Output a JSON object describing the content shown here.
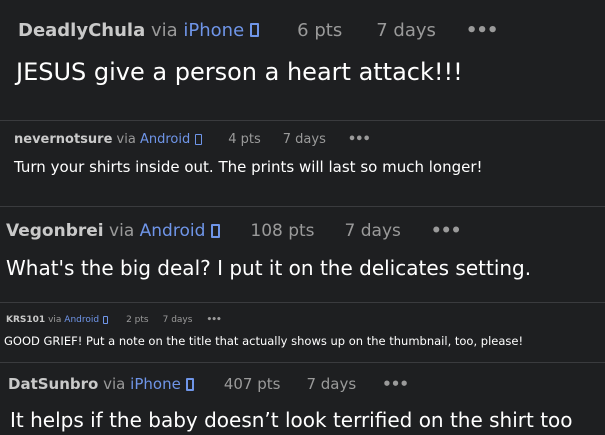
{
  "comments": [
    {
      "username": "DeadlyChula",
      "via": "via",
      "platform": "iPhone",
      "points": "6 pts",
      "age": "7 days",
      "more": "•••",
      "text": "JESUS give a person a heart attack!!!"
    },
    {
      "username": "nevernotsure",
      "via": "via",
      "platform": "Android",
      "points": "4 pts",
      "age": "7 days",
      "more": "•••",
      "text": "Turn your shirts inside out. The prints will last so much longer!"
    },
    {
      "username": "Vegonbrei",
      "via": "via",
      "platform": "Android",
      "points": "108 pts",
      "age": "7 days",
      "more": "•••",
      "text": "What's the big deal? I put it on the delicates setting."
    },
    {
      "username": "KRS101",
      "via": "via",
      "platform": "Android",
      "points": "2 pts",
      "age": "7 days",
      "more": "•••",
      "text": "GOOD GRIEF! Put a note on the title that actually shows up on the thumbnail, too, please!"
    },
    {
      "username": "DatSunbro",
      "via": "via",
      "platform": "iPhone",
      "points": "407 pts",
      "age": "7 days",
      "more": "•••",
      "text": "It helps if the baby doesn’t look terrified on the shirt too"
    }
  ],
  "colors": {
    "background": "#1e1f21",
    "platform_link": "#6f95e8",
    "meta_text": "#9a9a9a",
    "body_text": "#ffffff"
  }
}
